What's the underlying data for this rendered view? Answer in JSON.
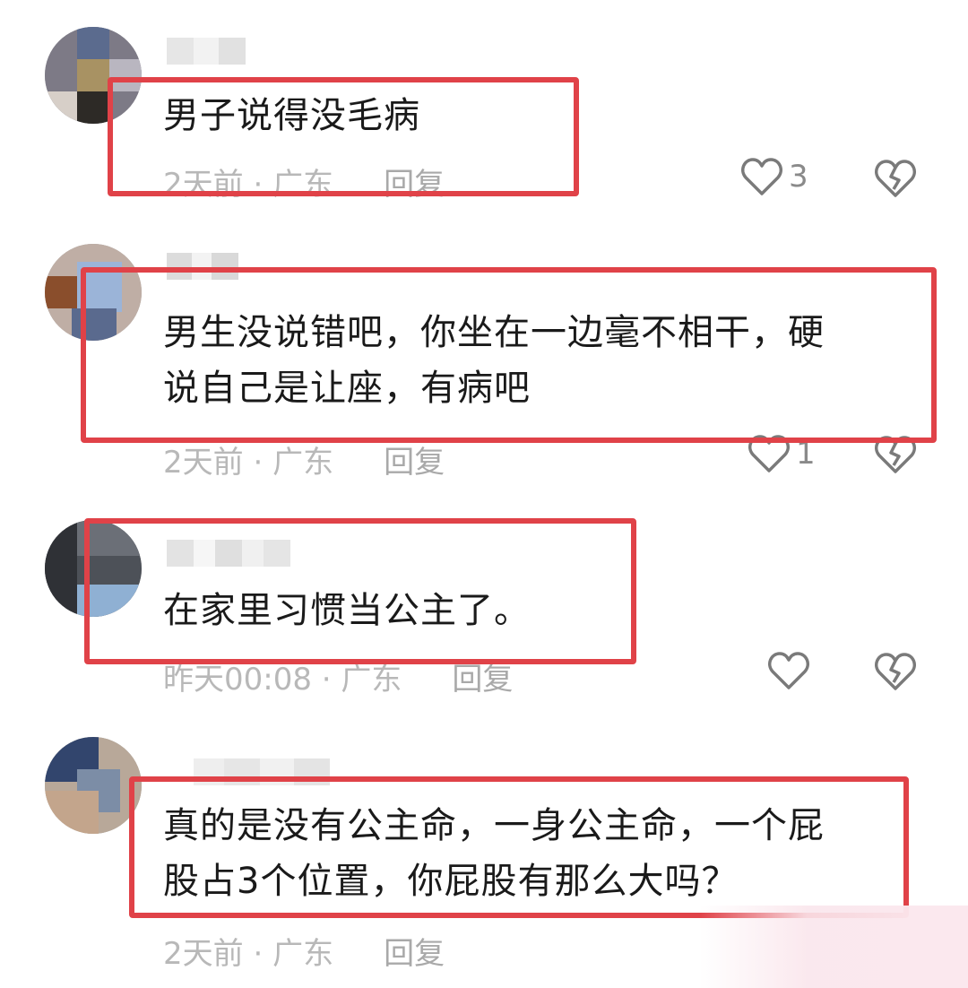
{
  "comments": [
    {
      "text_lines": [
        "男子说得没毛病"
      ],
      "time": "2天前",
      "location": "广东",
      "reply_label": "回复",
      "likes": "3"
    },
    {
      "text_lines": [
        "男生没说错吧，你坐在一边毫不相干，硬",
        "说自己是让座，有病吧"
      ],
      "time": "2天前",
      "location": "广东",
      "reply_label": "回复",
      "likes": "1"
    },
    {
      "text_lines": [
        "在家里习惯当公主了。"
      ],
      "time": "昨天00:08",
      "location": "广东",
      "reply_label": "回复",
      "likes": ""
    },
    {
      "text_lines": [
        "真的是没有公主命，一身公主命，一个屁",
        "股占3个位置，你屁股有那么大吗？"
      ],
      "time": "2天前",
      "location": "广东",
      "reply_label": "回复",
      "likes": ""
    }
  ],
  "icons": {
    "like": "heart-outline-icon",
    "dislike": "broken-heart-icon"
  },
  "colors": {
    "highlight": "#e04248",
    "meta": "#b8b8b8"
  }
}
